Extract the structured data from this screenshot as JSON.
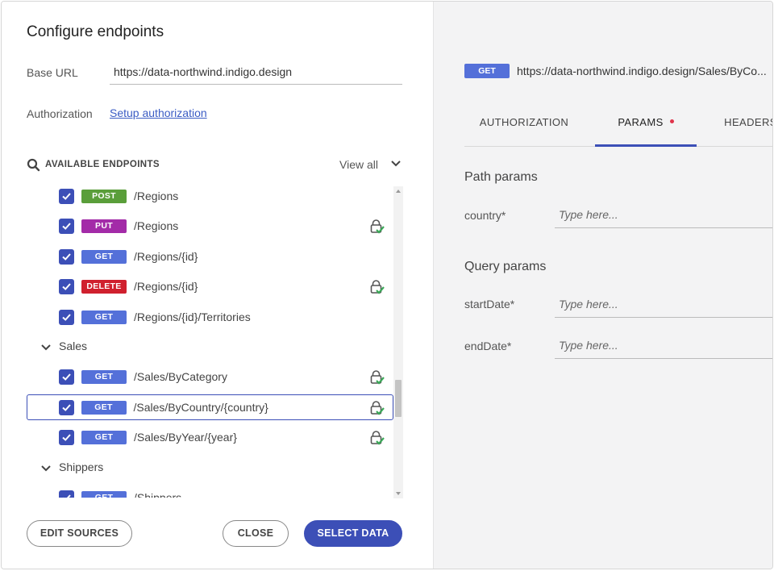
{
  "dialog": {
    "title": "Configure endpoints",
    "base_url_label": "Base URL",
    "base_url_value": "https://data-northwind.indigo.design",
    "authorization_label": "Authorization",
    "authorization_link": "Setup authorization",
    "endpoints_title": "AVAILABLE ENDPOINTS",
    "view_all": "View all",
    "buttons": {
      "edit_sources": "EDIT SOURCES",
      "close": "CLOSE",
      "select_data": "SELECT DATA"
    }
  },
  "colors": {
    "accent": "#3c4fb7",
    "post": "#5a9e3a",
    "put": "#a32ba8",
    "get": "#5470d9",
    "delete": "#d0202e",
    "lock_check": "#3aa757"
  },
  "endpoints": [
    {
      "method": "POST",
      "path": "/Regions",
      "checked": true,
      "secured": false
    },
    {
      "method": "PUT",
      "path": "/Regions",
      "checked": true,
      "secured": true
    },
    {
      "method": "GET",
      "path": "/Regions/{id}",
      "checked": true,
      "secured": false
    },
    {
      "method": "DELETE",
      "path": "/Regions/{id}",
      "checked": true,
      "secured": true
    },
    {
      "method": "GET",
      "path": "/Regions/{id}/Territories",
      "checked": true,
      "secured": false
    },
    {
      "group": "Sales"
    },
    {
      "method": "GET",
      "path": "/Sales/ByCategory",
      "checked": true,
      "secured": true
    },
    {
      "method": "GET",
      "path": "/Sales/ByCountry/{country}",
      "checked": true,
      "secured": true,
      "selected": true
    },
    {
      "method": "GET",
      "path": "/Sales/ByYear/{year}",
      "checked": true,
      "secured": true
    },
    {
      "group": "Shippers"
    },
    {
      "method": "GET",
      "path": "/Shippers",
      "checked": true,
      "secured": false
    }
  ],
  "detail": {
    "method": "GET",
    "url": "https://data-northwind.indigo.design/Sales/ByCo...",
    "tabs": [
      "AUTHORIZATION",
      "PARAMS",
      "HEADERS"
    ],
    "active_tab": "PARAMS",
    "path_params_title": "Path params",
    "query_params_title": "Query params",
    "path_params": [
      {
        "label": "country*",
        "placeholder": "Type here..."
      }
    ],
    "query_params": [
      {
        "label": "startDate*",
        "placeholder": "Type here..."
      },
      {
        "label": "endDate*",
        "placeholder": "Type here..."
      }
    ]
  }
}
